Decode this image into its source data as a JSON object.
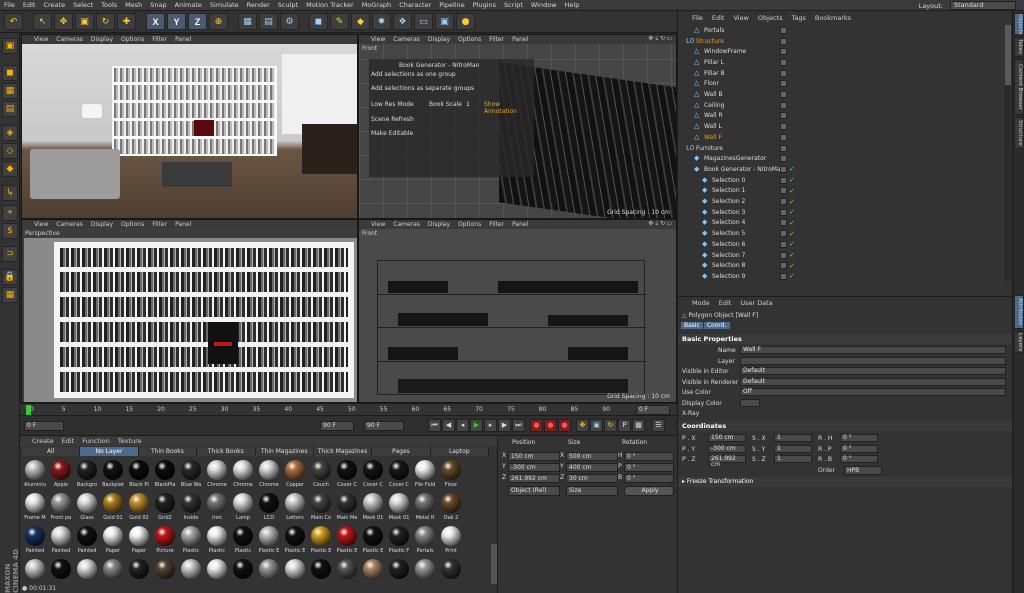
{
  "menu": [
    "File",
    "Edit",
    "Create",
    "Select",
    "Tools",
    "Mesh",
    "Snap",
    "Animate",
    "Simulate",
    "Render",
    "Sculpt",
    "Motion Tracker",
    "MoGraph",
    "Character",
    "Pipeline",
    "Plugins",
    "Script",
    "Window",
    "Help"
  ],
  "layout": {
    "label": "Layout:",
    "value": "Standard"
  },
  "toolbar": {
    "x": "X",
    "y": "Y",
    "z": "Z"
  },
  "viewport_menu": [
    "View",
    "Cameras",
    "Display",
    "Options",
    "Filter",
    "Panel"
  ],
  "viewports": {
    "tl": {
      "label": ""
    },
    "tr": {
      "label": "Front",
      "grid": "Grid Spacing : 10 cm"
    },
    "bl": {
      "label": "Perspective"
    },
    "br": {
      "label": "Front",
      "grid": "Grid Spacing : 10 cm"
    }
  },
  "overlay": {
    "title": "Book Generator -  NitroMan",
    "add_one": "Add selections as one group",
    "add_sep": "Add selections as separate groups",
    "lowres": "Low Res Mode",
    "scale_label": "Book Scale",
    "scale_value": "1",
    "annotation": "Show Annotation",
    "refresh": "Scene Refresh",
    "editable": "Make Editable"
  },
  "timeline": {
    "ticks": [
      "0",
      "5",
      "10",
      "15",
      "20",
      "25",
      "30",
      "35",
      "40",
      "45",
      "50",
      "55",
      "60",
      "65",
      "70",
      "75",
      "80",
      "85",
      "90"
    ],
    "frame_end": "0 F"
  },
  "playbar": {
    "start": "0 F",
    "mid": "90 F",
    "end": "90 F"
  },
  "material_menu": [
    "Create",
    "Edit",
    "Function",
    "Texture"
  ],
  "material_tabs": [
    "All",
    "No Layer",
    "Thin Books",
    "Thick Books",
    "Thin Magazines",
    "Thick Magazines",
    "Pages",
    "Laptop"
  ],
  "materials": [
    "Aluminiu",
    "Apple",
    "Backgro",
    "Backplat",
    "Black Pl",
    "BlackPla",
    "Blue Wa",
    "Chrome",
    "Chrome",
    "Chrome",
    "Copper",
    "Couch",
    "Cover C",
    "Cover C",
    "Cover C",
    "File Fold",
    "Floor",
    "Frame M",
    "Front pa",
    "Glass",
    "Gold 01",
    "Gold 02",
    "Grid2",
    "Inside",
    "Iron",
    "Lamp",
    "LCD",
    "Letters",
    "Main Co",
    "Main Me",
    "Mask 01",
    "Mask 01",
    "Metal R",
    "Oak 2",
    "Painted",
    "Painted",
    "Painted",
    "Paper",
    "Paper",
    "Picture",
    "Plastic",
    "Plastic",
    "Plastic",
    "Plastic E",
    "Plastic E",
    "Plastic E",
    "Plastic E",
    "Plastic E",
    "Plastic F",
    "Portals",
    "Print",
    "",
    "",
    "",
    "",
    "",
    "",
    "",
    "",
    "",
    "",
    "",
    "",
    "",
    "",
    "",
    "",
    ""
  ],
  "maxon": "MAXON CINEMA 4D",
  "time_display": "00:01:31",
  "coords": {
    "headers": [
      "Position",
      "Size",
      "Rotation"
    ],
    "rows": [
      {
        "axis": "X",
        "pos": "150 cm",
        "size": "500 cm",
        "rot_axis": "H",
        "rot": "0 °"
      },
      {
        "axis": "Y",
        "pos": "-300 cm",
        "size": "400 cm",
        "rot_axis": "P",
        "rot": "0 °"
      },
      {
        "axis": "Z",
        "pos": "261.992 cm",
        "size": "30 cm",
        "rot_axis": "B",
        "rot": "0 °"
      }
    ],
    "mode1": "Object (Rel)",
    "mode2": "Size",
    "apply": "Apply"
  },
  "objects_menu": [
    "File",
    "Edit",
    "View",
    "Objects",
    "Tags",
    "Bookmarks"
  ],
  "objects": [
    {
      "name": "Portals",
      "indent": 1,
      "ico": "△"
    },
    {
      "name": "Structure",
      "indent": 0,
      "ico": "L0",
      "hl": true
    },
    {
      "name": "WindowFrame",
      "indent": 1,
      "ico": "△"
    },
    {
      "name": "Pillar L",
      "indent": 1,
      "ico": "△"
    },
    {
      "name": "Pillar B",
      "indent": 1,
      "ico": "△"
    },
    {
      "name": "Floor",
      "indent": 1,
      "ico": "△"
    },
    {
      "name": "Wall B",
      "indent": 1,
      "ico": "△"
    },
    {
      "name": "Ceiling",
      "indent": 1,
      "ico": "△"
    },
    {
      "name": "Wall R",
      "indent": 1,
      "ico": "△"
    },
    {
      "name": "Wall L",
      "indent": 1,
      "ico": "△"
    },
    {
      "name": "Wall F",
      "indent": 1,
      "ico": "△",
      "hl": true
    },
    {
      "name": "Furniture",
      "indent": 0,
      "ico": "L0"
    },
    {
      "name": "MagazinesGenerator",
      "indent": 1,
      "ico": "◆"
    },
    {
      "name": "Book Generator -  NitroMan",
      "indent": 1,
      "ico": "◆"
    },
    {
      "name": "Selection 0",
      "indent": 2,
      "ico": "◆"
    },
    {
      "name": "Selection 1",
      "indent": 2,
      "ico": "◆"
    },
    {
      "name": "Selection 2",
      "indent": 2,
      "ico": "◆"
    },
    {
      "name": "Selection 3",
      "indent": 2,
      "ico": "◆"
    },
    {
      "name": "Selection 4",
      "indent": 2,
      "ico": "◆"
    },
    {
      "name": "Selection 5",
      "indent": 2,
      "ico": "◆"
    },
    {
      "name": "Selection 6",
      "indent": 2,
      "ico": "◆"
    },
    {
      "name": "Selection 7",
      "indent": 2,
      "ico": "◆"
    },
    {
      "name": "Selection 8",
      "indent": 2,
      "ico": "◆"
    },
    {
      "name": "Selection 9",
      "indent": 2,
      "ico": "◆"
    }
  ],
  "attr_menu": [
    "Mode",
    "Edit",
    "User Data"
  ],
  "attr": {
    "title": "Polygon Object [Wall F]",
    "tab_basic": "Basic",
    "tab_coord": "Coord.",
    "section_basic": "Basic Properties",
    "props": [
      {
        "label": "Name",
        "value": "Wall F"
      },
      {
        "label": "Layer",
        "value": ""
      },
      {
        "label": "Visible in Editor",
        "value": "Default"
      },
      {
        "label": "Visible in Renderer",
        "value": "Default"
      },
      {
        "label": "Use Color",
        "value": "Off"
      },
      {
        "label": "Display Color",
        "value": ""
      },
      {
        "label": "X-Ray",
        "value": ""
      }
    ],
    "section_coords": "Coordinates",
    "coord_rows": [
      {
        "p": "P . X",
        "pv": "150 cm",
        "s": "S . X",
        "sv": "1",
        "r": "R . H",
        "rv": "0 °"
      },
      {
        "p": "P . Y",
        "pv": "-300 cm",
        "s": "S . Y",
        "sv": "1",
        "r": "R . P",
        "rv": "0 °"
      },
      {
        "p": "P . Z",
        "pv": "261.992 cm",
        "s": "S . Z",
        "sv": "1",
        "r": "R . B",
        "rv": "0 °"
      }
    ],
    "order_label": "Order",
    "order_value": "HPB",
    "freeze": "Freeze Transformation"
  },
  "side_tabs": [
    "Objects",
    "Takes",
    "Content Browser",
    "Structure"
  ],
  "side_tabs2": [
    "Attributes",
    "Layers"
  ]
}
